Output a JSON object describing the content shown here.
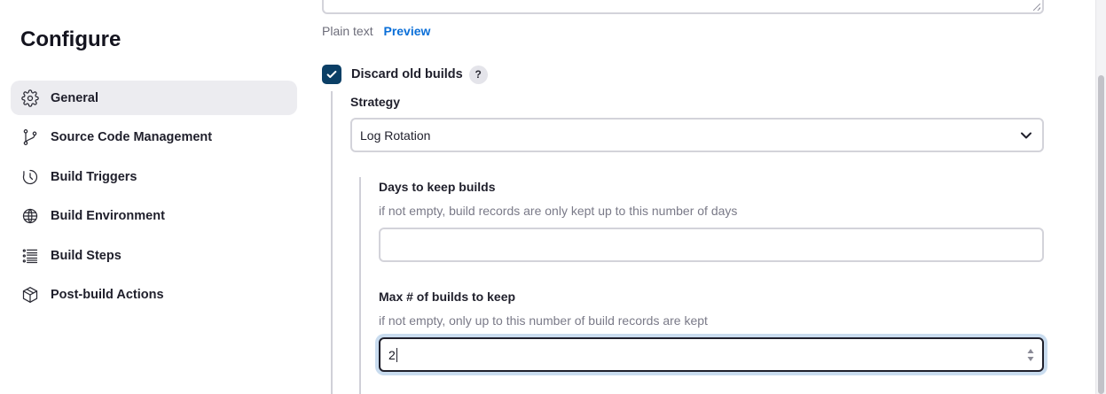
{
  "page": {
    "title": "Configure"
  },
  "sidebar": {
    "items": [
      {
        "label": "General",
        "icon": "gear-icon",
        "active": true
      },
      {
        "label": "Source Code Management",
        "icon": "git-branch-icon",
        "active": false
      },
      {
        "label": "Build Triggers",
        "icon": "clock-icon",
        "active": false
      },
      {
        "label": "Build Environment",
        "icon": "globe-icon",
        "active": false
      },
      {
        "label": "Build Steps",
        "icon": "list-icon",
        "active": false
      },
      {
        "label": "Post-build Actions",
        "icon": "package-icon",
        "active": false
      }
    ]
  },
  "description": {
    "format_label": "Plain text",
    "preview_link": "Preview"
  },
  "discard": {
    "label": "Discard old builds",
    "checked": true,
    "help": "?"
  },
  "strategy": {
    "label": "Strategy",
    "selected": "Log Rotation"
  },
  "days_to_keep": {
    "label": "Days to keep builds",
    "description": "if not empty, build records are only kept up to this number of days",
    "value": ""
  },
  "max_builds": {
    "label": "Max # of builds to keep",
    "description": "if not empty, only up to this number of build records are kept",
    "value": "2"
  },
  "colors": {
    "accent": "#0b6fd8",
    "checkbox": "#0b3f66",
    "active_nav_bg": "#ececf0",
    "focus_ring": "#c9dcef"
  }
}
